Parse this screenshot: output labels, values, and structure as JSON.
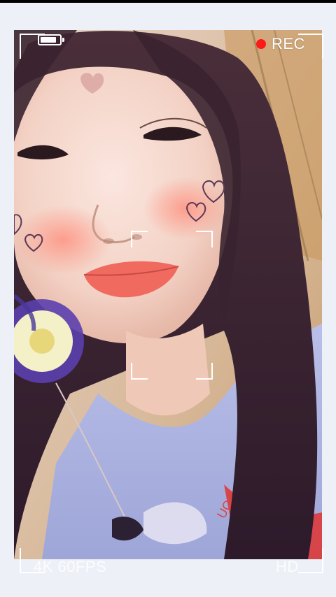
{
  "viewfinder": {
    "rec_label": "REC",
    "format_label": "4K 60FPS",
    "quality_label": "HD",
    "battery_level": 0.85,
    "rec_color": "#ff1a1a",
    "frame_color": "#ffffff"
  },
  "icons": {
    "battery": "battery-icon",
    "record_dot": "record-dot-icon"
  }
}
